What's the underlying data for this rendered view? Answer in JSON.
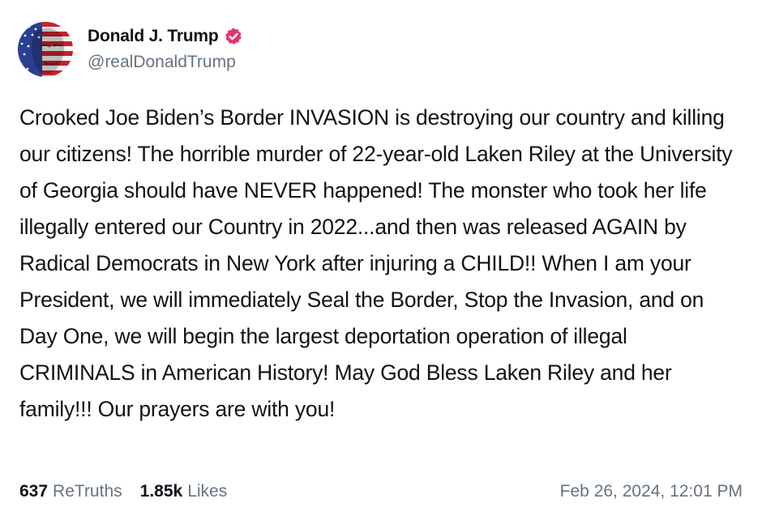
{
  "author": {
    "display_name": "Donald J. Trump",
    "handle": "@realDonaldTrump",
    "verified": true,
    "avatar_icon": "flag-portrait-avatar"
  },
  "post": {
    "text": "Crooked Joe Biden’s Border INVASION is destroying our country and killing our citizens! The horrible murder of 22-year-old Laken Riley at the University of Georgia should have NEVER happened! The monster who took her life illegally entered our Country in 2022...and then was released AGAIN by Radical Democrats in New York after injuring a CHILD!! When I am your President, we will immediately Seal the Border, Stop the Invasion, and on Day One, we will begin the largest deportation operation of illegal CRIMINALS in American History! May God Bless Laken Riley and her family!!! Our prayers are with you!"
  },
  "stats": {
    "retruths_count": "637",
    "retruths_label": "ReTruths",
    "likes_count": "1.85k",
    "likes_label": "Likes"
  },
  "timestamp": "Feb 26, 2024, 12:01 PM",
  "colors": {
    "text_primary": "#0f1419",
    "text_secondary": "#657380",
    "verified_badge": "#e0376f"
  }
}
